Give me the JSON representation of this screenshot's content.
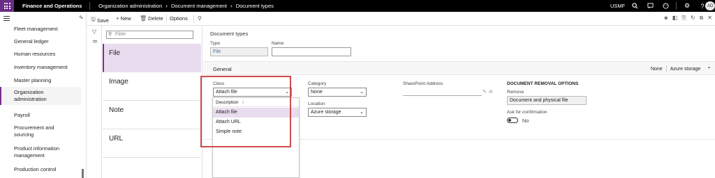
{
  "topbar": {
    "app_name": "Finance and Operations",
    "breadcrumb": [
      "Organization administration",
      "Document management",
      "Document types"
    ],
    "company": "USMF",
    "avatar_initials": "AD",
    "icons": [
      "search-icon",
      "chat-icon",
      "smiley-icon",
      "gear-icon",
      "help-icon"
    ]
  },
  "nav": {
    "items": [
      {
        "label": "Fleet management"
      },
      {
        "label": "General ledger"
      },
      {
        "label": "Human resources"
      },
      {
        "label": "Inventory management"
      },
      {
        "label": "Master planning"
      },
      {
        "label": "Organization administration",
        "lines": [
          "Organization",
          "administration"
        ],
        "active": true
      },
      {
        "label": "Payroll"
      },
      {
        "label": "Procurement and sourcing",
        "lines": [
          "Procurement and",
          "sourcing"
        ]
      },
      {
        "label": "Product information management",
        "lines": [
          "Product information",
          "management"
        ]
      },
      {
        "label": "Production control"
      }
    ]
  },
  "actionbar": {
    "save": "Save",
    "new": "New",
    "delete": "Delete",
    "options": "Options"
  },
  "list": {
    "filter_placeholder": "Filter",
    "items": [
      "File",
      "Image",
      "Note",
      "URL"
    ],
    "selected": "File"
  },
  "details": {
    "title": "Document types",
    "type_label": "Type",
    "type_value": "File",
    "name_label": "Name",
    "name_value": "",
    "general": {
      "title": "General",
      "summary": [
        "None",
        "Azure storage"
      ],
      "class_label": "Class",
      "class_value": "Attach file",
      "category_label": "Category",
      "category_value": "None",
      "location_label": "Location",
      "location_value": "Azure storage",
      "sharepoint_label": "SharePoint Address",
      "sharepoint_value": "",
      "removal_heading": "DOCUMENT REMOVAL OPTIONS",
      "remove_label": "Remove",
      "remove_value": "Document and physical file",
      "ask_label": "Ask for confirmation",
      "ask_value": "No"
    }
  },
  "class_dropdown": {
    "header": "Description",
    "sort_indicator": "↑",
    "options": [
      "Attach file",
      "Attach URL",
      "Simple note"
    ],
    "selected": "Attach file"
  },
  "colors": {
    "accent": "#7a2f8f",
    "selection": "#e9dcef",
    "highlight_box": "#d04a4a"
  }
}
